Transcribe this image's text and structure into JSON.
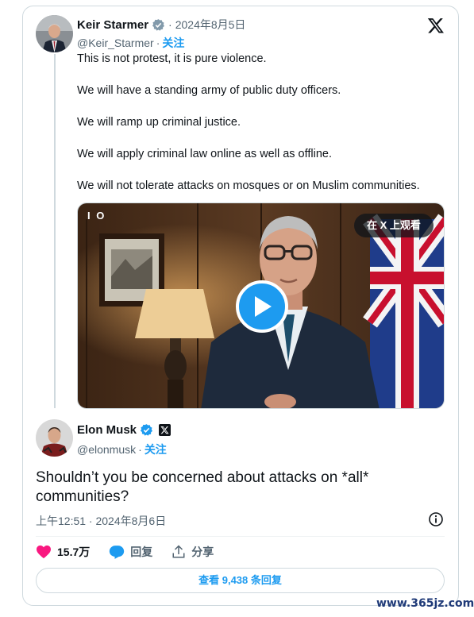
{
  "original_tweet": {
    "author_name": "Keir Starmer",
    "date": "2024年8月5日",
    "separator": "·",
    "handle": "@Keir_Starmer",
    "follow_label": "关注",
    "lines": [
      "This is not protest, it is pure violence.",
      "We will have a standing army of public duty officers.",
      "We will ramp up criminal justice.",
      "We will apply criminal law online as well as offline.",
      "We will not tolerate attacks on mosques or on Muslim communities."
    ],
    "media": {
      "corner_text": "I O",
      "watch_on_x_label": "在 X 上观看"
    }
  },
  "reply_tweet": {
    "author_name": "Elon Musk",
    "handle": "@elonmusk",
    "separator": "·",
    "follow_label": "关注",
    "text": "Shouldn’t you be concerned about attacks on *all* communities?",
    "timestamp": "上午12:51 · 2024年8月6日"
  },
  "actions": {
    "likes": "15.7万",
    "reply_label": "回复",
    "share_label": "分享"
  },
  "more_replies_label": "查看 9,438 条回复",
  "watermark": "www.365jz.com",
  "colors": {
    "accent": "#1d9bf0",
    "like": "#f91880",
    "text": "#0f1419",
    "secondary": "#536471",
    "border": "#cfd9de"
  },
  "icons": [
    "verified-badge-icon",
    "x-logo-icon",
    "play-icon",
    "info-icon",
    "heart-icon",
    "reply-bubble-icon",
    "share-icon",
    "x-affiliate-badge-icon"
  ]
}
